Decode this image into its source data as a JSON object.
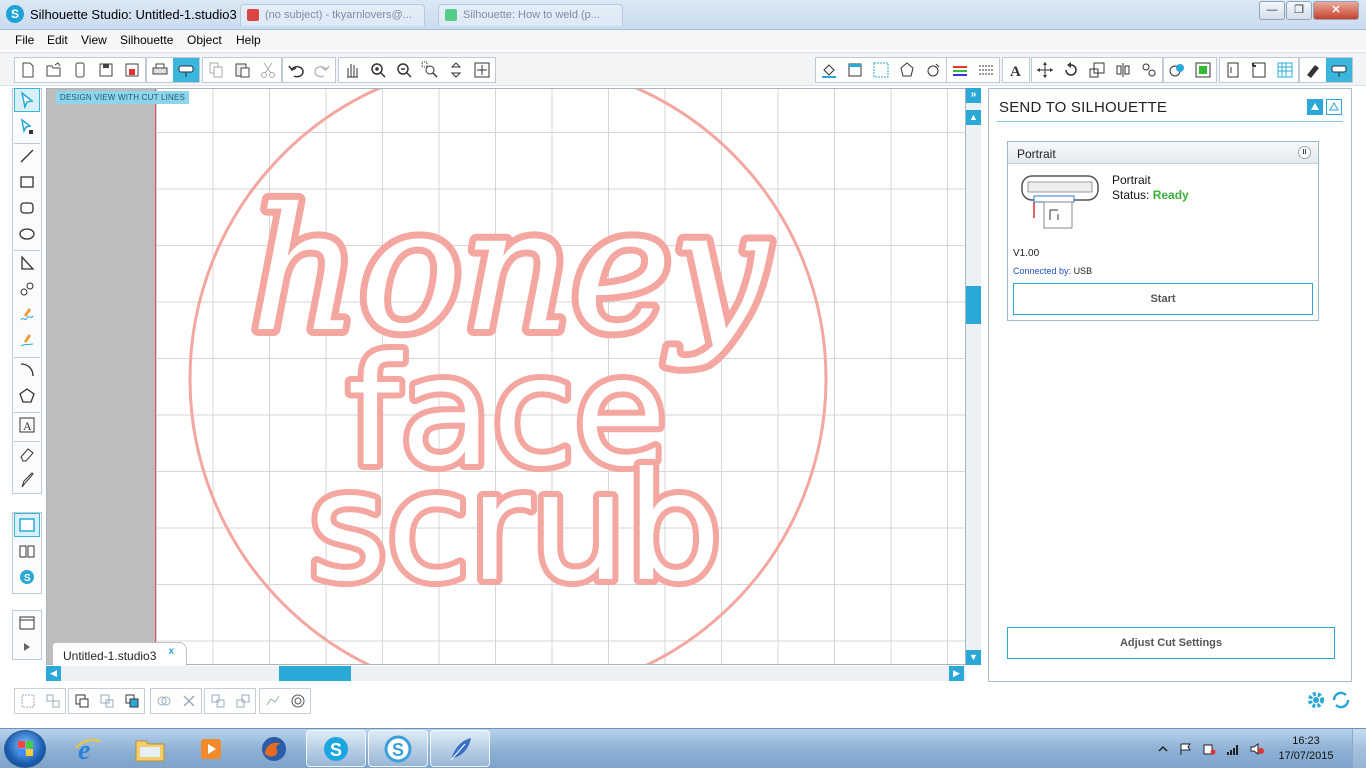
{
  "window": {
    "title": "Silhouette Studio: Untitled-1.studio3",
    "bg_tabs": [
      "(no subject) - tkyarnlovers@...",
      "Silhouette: How to weld (p..."
    ],
    "controls": [
      "—",
      "❐",
      "✕"
    ]
  },
  "menu": [
    "File",
    "Edit",
    "View",
    "Silhouette",
    "Object",
    "Help"
  ],
  "canvas": {
    "view_label": "DESIGN VIEW WITH CUT LINES",
    "design_text": [
      "honey",
      "face",
      "scrub"
    ],
    "cut_line_color": "#f4a6a0"
  },
  "doc_tab": {
    "label": "Untitled-1.studio3",
    "close": "x"
  },
  "scroll": {
    "up": "▲",
    "down": "▼",
    "left": "◀",
    "right": "▶",
    "collapse": "»"
  },
  "send_panel": {
    "title": "SEND TO SILHOUETTE",
    "device": {
      "header": "Portrait",
      "name": "Portrait",
      "status_label": "Status:",
      "status_value": "Ready",
      "version": "V1.00",
      "connected_label": "Connected by:",
      "connected_value": "USB",
      "start_label": "Start",
      "pause_label": "II"
    },
    "adjust_label": "Adjust Cut Settings",
    "accent_color": "#2aa8d8",
    "ready_color": "#3ab23a"
  },
  "taskbar": {
    "time": "16:23",
    "date": "17/07/2015"
  }
}
